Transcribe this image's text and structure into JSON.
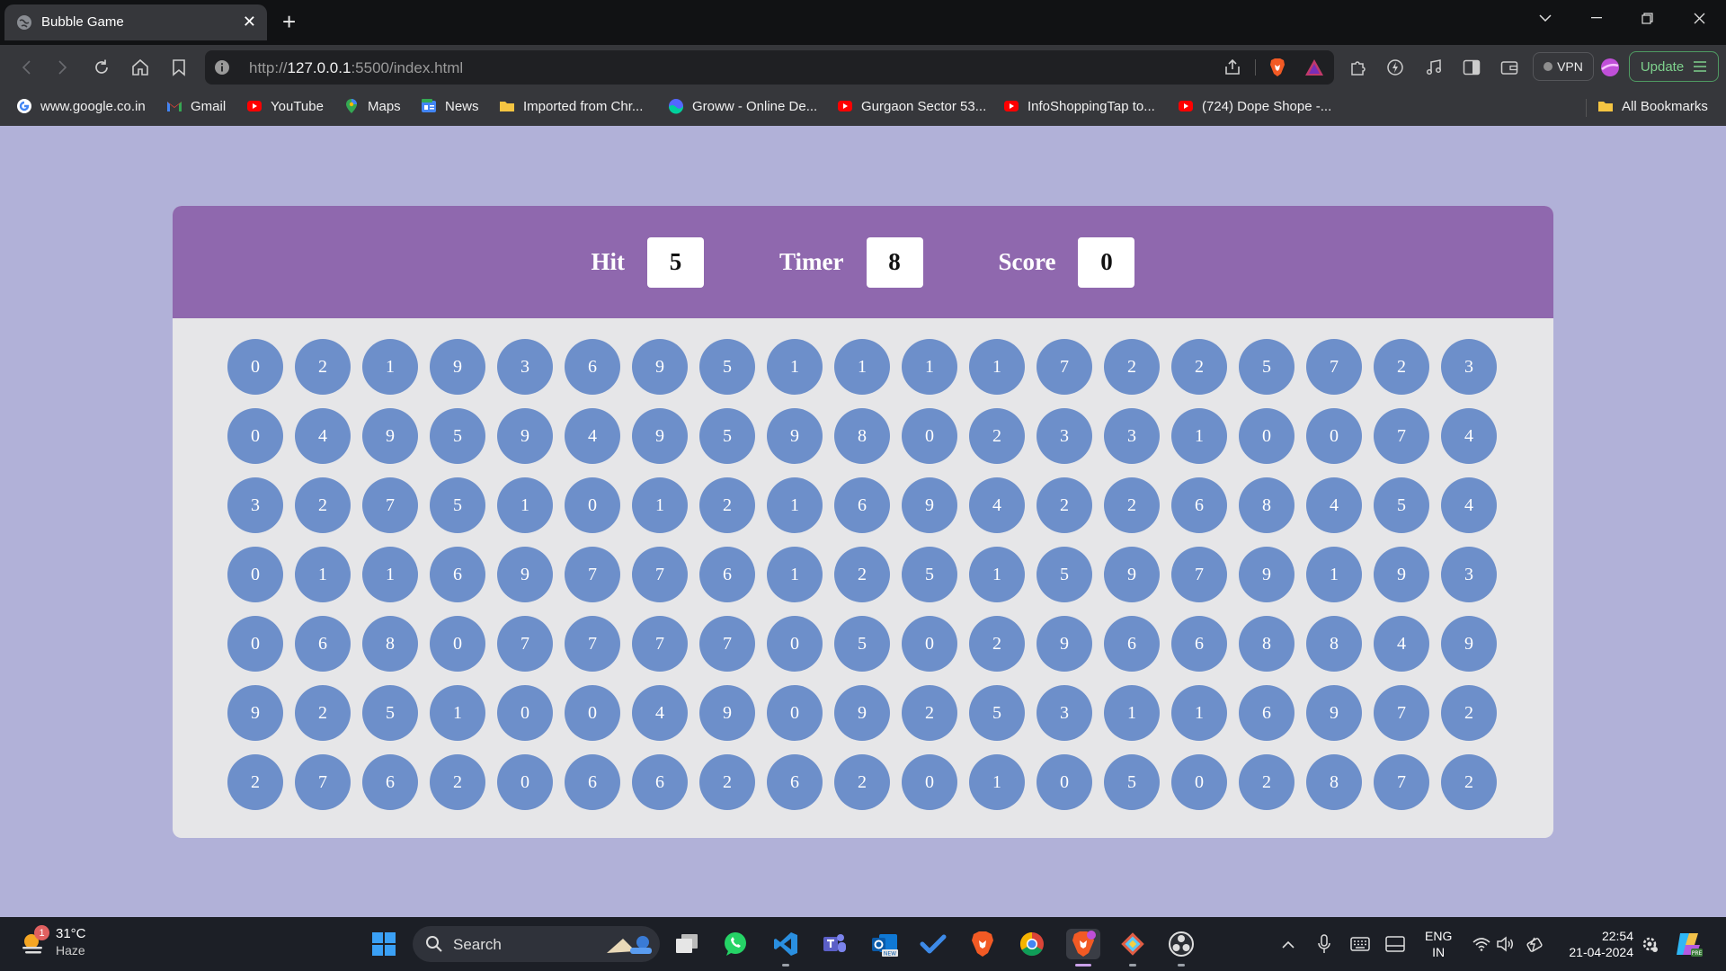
{
  "browser": {
    "tab_title": "Bubble Game",
    "url_prefix": "http://",
    "url_host": "127.0.0.1",
    "url_path": ":5500/index.html",
    "vpn_label": "VPN",
    "update_label": "Update"
  },
  "bookmarks": [
    {
      "label": "www.google.co.in",
      "icon": "google-icon"
    },
    {
      "label": "Gmail",
      "icon": "gmail-icon"
    },
    {
      "label": "YouTube",
      "icon": "youtube-icon"
    },
    {
      "label": "Maps",
      "icon": "maps-icon"
    },
    {
      "label": "News",
      "icon": "news-icon"
    },
    {
      "label": "Imported from Chr...",
      "icon": "folder-icon"
    },
    {
      "label": "Groww - Online De...",
      "icon": "groww-icon"
    },
    {
      "label": "Gurgaon Sector 53...",
      "icon": "youtube-icon"
    },
    {
      "label": "InfoShoppingTap to...",
      "icon": "youtube-icon"
    },
    {
      "label": "(724) Dope Shope -...",
      "icon": "youtube-icon"
    }
  ],
  "all_bookmarks_label": "All Bookmarks",
  "game": {
    "hit_label": "Hit",
    "hit_value": "5",
    "timer_label": "Timer",
    "timer_value": "8",
    "score_label": "Score",
    "score_value": "0",
    "bubble_color": "#6d8fca",
    "panel_color": "#8f68ae",
    "bubbles": [
      [
        0,
        2,
        1,
        9,
        3,
        6,
        9,
        5,
        1,
        1,
        1,
        1,
        7,
        2,
        2,
        5,
        7,
        2,
        3
      ],
      [
        0,
        4,
        9,
        5,
        9,
        4,
        9,
        5,
        9,
        8,
        0,
        2,
        3,
        3,
        1,
        0,
        0,
        7,
        4
      ],
      [
        3,
        2,
        7,
        5,
        1,
        0,
        1,
        2,
        1,
        6,
        9,
        4,
        2,
        2,
        6,
        8,
        4,
        5,
        4
      ],
      [
        0,
        1,
        1,
        6,
        9,
        7,
        7,
        6,
        1,
        2,
        5,
        1,
        5,
        9,
        7,
        9,
        1,
        9,
        3
      ],
      [
        0,
        6,
        8,
        0,
        7,
        7,
        7,
        7,
        0,
        5,
        0,
        2,
        9,
        6,
        6,
        8,
        8,
        4,
        9
      ],
      [
        9,
        2,
        5,
        1,
        0,
        0,
        4,
        9,
        0,
        9,
        2,
        5,
        3,
        1,
        1,
        6,
        9,
        7,
        2
      ],
      [
        2,
        7,
        6,
        2,
        0,
        6,
        6,
        2,
        6,
        2,
        0,
        1,
        0,
        5,
        0,
        2,
        8,
        7,
        2
      ]
    ]
  },
  "taskbar": {
    "weather_temp": "31°C",
    "weather_cond": "Haze",
    "weather_badge": "1",
    "search_label": "Search",
    "lang_line1": "ENG",
    "lang_line2": "IN",
    "time": "22:54",
    "date": "21-04-2024"
  }
}
